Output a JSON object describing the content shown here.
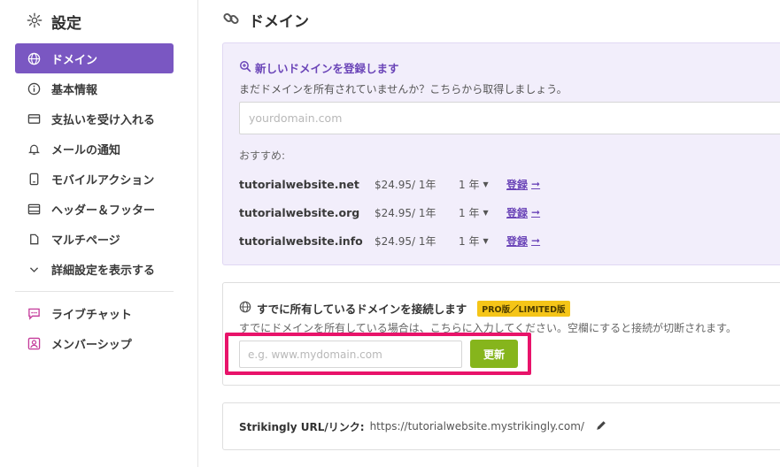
{
  "sidebar": {
    "title": "設定",
    "items": [
      {
        "label": "ドメイン",
        "icon": "globe-icon",
        "active": true
      },
      {
        "label": "基本情報",
        "icon": "info-icon"
      },
      {
        "label": "支払いを受け入れる",
        "icon": "payment-icon"
      },
      {
        "label": "メールの通知",
        "icon": "bell-icon"
      },
      {
        "label": "モバイルアクション",
        "icon": "mobile-icon"
      },
      {
        "label": "ヘッダー＆フッター",
        "icon": "header-footer-icon"
      },
      {
        "label": "マルチページ",
        "icon": "pages-icon"
      },
      {
        "label": "詳細設定を表示する",
        "icon": "chevron-down-icon"
      }
    ],
    "items2": [
      {
        "label": "ライブチャット",
        "icon": "chat-icon"
      },
      {
        "label": "メンバーシップ",
        "icon": "member-icon"
      }
    ]
  },
  "main": {
    "title": "ドメイン",
    "register": {
      "heading": "新しいドメインを登録します",
      "subtitle": "まだドメインを所有されていませんか？こちらから取得しましょう。",
      "placeholder": "yourdomain.com",
      "recommended_label": "おすすめ:",
      "suggestions": [
        {
          "domain": "tutorialwebsite.net",
          "price": "$24.95/ 1年",
          "years": "1 年",
          "action": "登録"
        },
        {
          "domain": "tutorialwebsite.org",
          "price": "$24.95/ 1年",
          "years": "1 年",
          "action": "登録"
        },
        {
          "domain": "tutorialwebsite.info",
          "price": "$24.95/ 1年",
          "years": "1 年",
          "action": "登録"
        }
      ]
    },
    "connect": {
      "heading": "すでに所有しているドメインを接続します",
      "badge": "PRO版／LIMITED版",
      "subtitle": "すでにドメインを所有している場合は、こちらに入力してください。空欄にすると接続が切断されます。",
      "placeholder": "e.g. www.mydomain.com",
      "button": "更新"
    },
    "url": {
      "label": "Strikingly URL/リンク:",
      "value": "https://tutorialwebsite.mystrikingly.com/"
    }
  },
  "colors": {
    "accent": "#7a57c2",
    "button": "#86b51c",
    "highlight": "#e8136a",
    "badge": "#f5c518"
  }
}
